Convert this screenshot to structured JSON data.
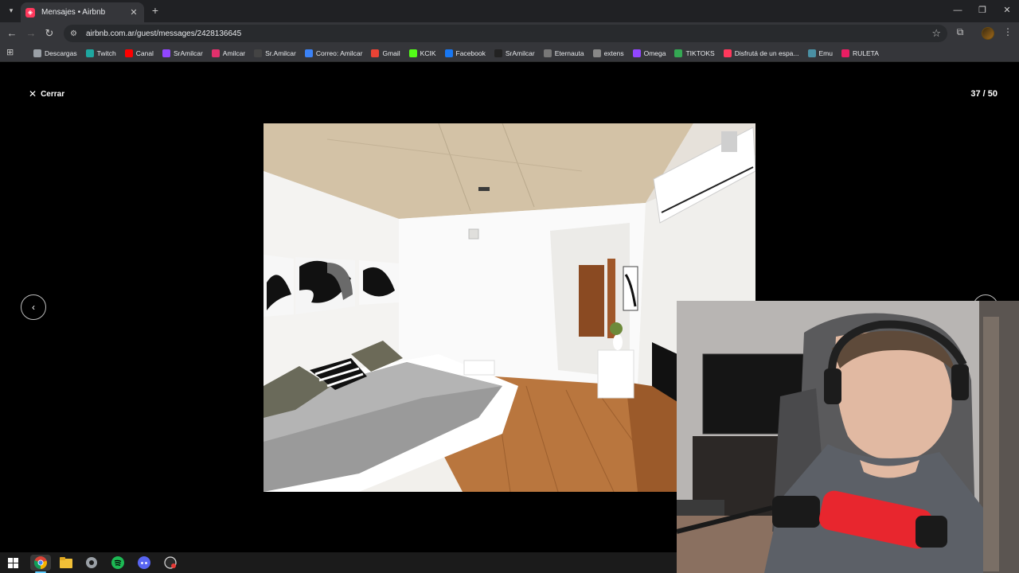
{
  "browser": {
    "tab": {
      "title": "Mensajes • Airbnb"
    },
    "url": "airbnb.com.ar/guest/messages/2428136645",
    "bookmarks": [
      {
        "label": "Descargas",
        "color": "#9aa0a6",
        "icon": "download-icon"
      },
      {
        "label": "Twitch",
        "color": "#1ea7a0",
        "icon": "twitch-icon"
      },
      {
        "label": "Canal",
        "color": "#ff0000",
        "icon": "youtube-icon"
      },
      {
        "label": "SrAmilcar",
        "color": "#9146ff",
        "icon": "twitch-icon"
      },
      {
        "label": "Amilcar",
        "color": "#e1306c",
        "icon": "instagram-icon"
      },
      {
        "label": "Sr.Amilcar",
        "color": "#444444",
        "icon": "x-icon"
      },
      {
        "label": "Correo: Amilcar",
        "color": "#3b82f6",
        "icon": "mail-icon"
      },
      {
        "label": "Gmail",
        "color": "#ea4335",
        "icon": "gmail-icon"
      },
      {
        "label": "KCIK",
        "color": "#53fc18",
        "icon": "kick-icon"
      },
      {
        "label": "Facebook",
        "color": "#1877f2",
        "icon": "facebook-icon"
      },
      {
        "label": "SrAmilcar",
        "color": "#222222",
        "icon": "tiktok-icon"
      },
      {
        "label": "Eternauta",
        "color": "#777777",
        "icon": "document-icon"
      },
      {
        "label": "extens",
        "color": "#888888",
        "icon": "puzzle-icon"
      },
      {
        "label": "Omega",
        "color": "#9146ff",
        "icon": "twitch-icon"
      },
      {
        "label": "TIKTOKS",
        "color": "#34a853",
        "icon": "drive-icon"
      },
      {
        "label": "Disfrutá de un espa...",
        "color": "#ff385c",
        "icon": "airbnb-icon"
      },
      {
        "label": "Emu",
        "color": "#4a90a4",
        "icon": "emu-icon"
      },
      {
        "label": "RULETA",
        "color": "#e91e63",
        "icon": "roulette-icon"
      }
    ]
  },
  "gallery": {
    "close_label": "Cerrar",
    "counter": "37 / 50",
    "current_photo": 37,
    "total_photos": 50
  },
  "taskbar": {
    "items": [
      "windows-start-icon",
      "chrome-icon",
      "file-explorer-icon",
      "app-icon",
      "spotify-icon",
      "discord-icon",
      "obs-icon"
    ]
  },
  "colors": {
    "airbnb_brand": "#ff385c",
    "chrome_dark": "#202124",
    "chrome_toolbar": "#35363a"
  }
}
